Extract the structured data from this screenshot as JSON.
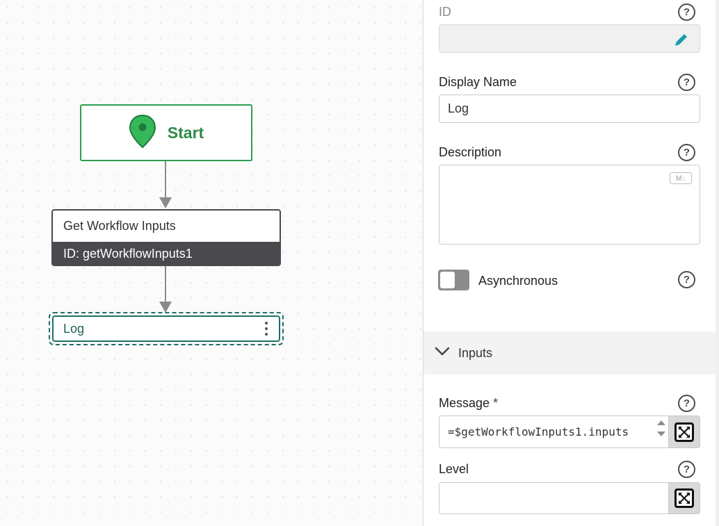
{
  "canvas": {
    "start_node": {
      "label": "Start",
      "icon": "map-pin-icon",
      "color": "#2e9e4f"
    },
    "get_inputs_node": {
      "title": "Get Workflow Inputs",
      "id_text": "ID: getWorkflowInputs1"
    },
    "log_node": {
      "label": "Log",
      "menu_icon": "kebab-menu-icon"
    }
  },
  "panel": {
    "id_field": {
      "label": "ID",
      "value": "",
      "edit_icon": "pencil-icon"
    },
    "display_name": {
      "label": "Display Name",
      "value": "Log"
    },
    "description": {
      "label": "Description",
      "value": "",
      "badge": "M↓"
    },
    "asynchronous": {
      "label": "Asynchronous",
      "enabled": false
    },
    "inputs_section": {
      "label": "Inputs",
      "expanded": true
    },
    "message": {
      "label": "Message",
      "required_mark": "*",
      "value": "=$getWorkflowInputs1.inputs"
    },
    "level": {
      "label": "Level",
      "value": ""
    },
    "help_glyph": "?"
  },
  "colors": {
    "accent_teal": "#1f6f66",
    "start_green": "#2e8b47",
    "node_dark": "#4a494d",
    "pencil": "#1a9bb0"
  }
}
